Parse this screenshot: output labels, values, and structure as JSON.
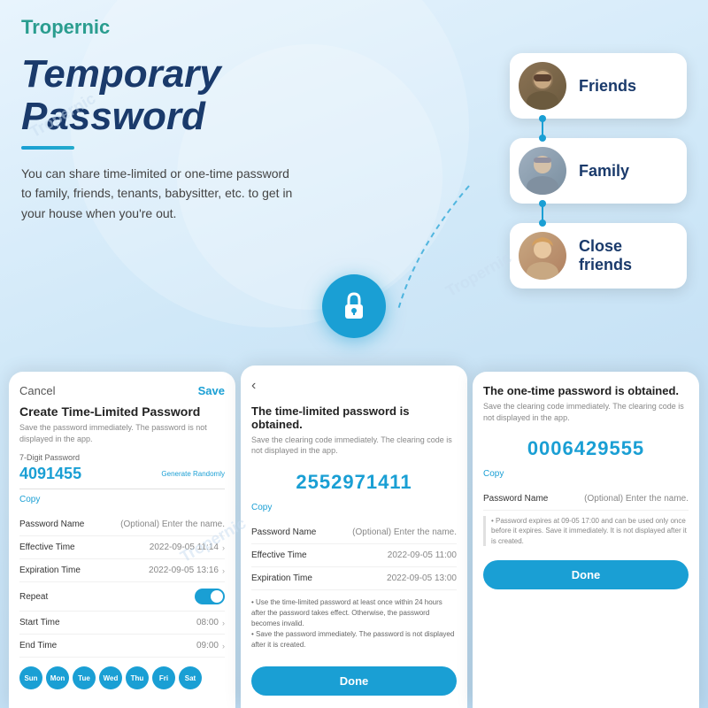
{
  "brand": {
    "logo": "Tropernic"
  },
  "hero": {
    "title_line1": "Temporary",
    "title_line2": "Password",
    "subtitle": "You can share time-limited or one-time password to family, friends, tenants, babysitter, etc. to get in your house when you're out."
  },
  "person_cards": [
    {
      "name": "Friends",
      "avatar_type": "man1"
    },
    {
      "name": "Family",
      "avatar_type": "man2"
    },
    {
      "name": "Close friends",
      "avatar_type": "woman"
    }
  ],
  "phone1": {
    "cancel_label": "Cancel",
    "save_label": "Save",
    "title": "Create Time-Limited Password",
    "subtitle": "Save the password immediately. The password is not displayed in the app.",
    "field_label": "7-Digit Password",
    "password_value": "4091455",
    "gen_btn": "Generate Randomly",
    "copy_label": "Copy",
    "rows": [
      {
        "label": "Password Name",
        "value": "(Optional) Enter the name."
      },
      {
        "label": "Effective Time",
        "value": "2022-09-05 11:14"
      },
      {
        "label": "Expiration Time",
        "value": "2022-09-05 13:16"
      },
      {
        "label": "Repeat",
        "value": ""
      },
      {
        "label": "Start Time",
        "value": "08:00"
      },
      {
        "label": "End Time",
        "value": "09:00"
      }
    ],
    "days": [
      "Sun",
      "Mon",
      "Tue",
      "Wed",
      "Thu",
      "Fri",
      "Sat"
    ],
    "days_active": [
      0,
      1,
      2,
      3,
      4,
      5,
      6
    ]
  },
  "phone2": {
    "obtained_title": "The time-limited password is obtained.",
    "obtained_sub": "Save the clearing code immediately. The clearing code is not displayed in the app.",
    "code": "2552971411",
    "copy_label": "Copy",
    "rows": [
      {
        "label": "Password Name",
        "value": "(Optional) Enter the name."
      },
      {
        "label": "Effective Time",
        "value": "2022-09-05 11:00"
      },
      {
        "label": "Expiration Time",
        "value": "2022-09-05 13:00"
      }
    ],
    "note1": "• Use the time-limited password at least once within 24 hours after the password takes effect. Otherwise, the password becomes invalid.",
    "note2": "• Save the password immediately. The password is not displayed after it is created.",
    "done_label": "Done"
  },
  "phone3": {
    "obtained_title": "The one-time password is obtained.",
    "obtained_sub": "Save the clearing code immediately. The clearing code is not displayed in the app.",
    "code": "0006429555",
    "copy_label": "Copy",
    "rows": [
      {
        "label": "Password Name",
        "value": "(Optional) Enter the name."
      }
    ],
    "note": "• Password expires at 09-05 17:00 and can be used only once before it expires. Save it immediately. It is not displayed after it is created.",
    "done_label": "Done"
  }
}
